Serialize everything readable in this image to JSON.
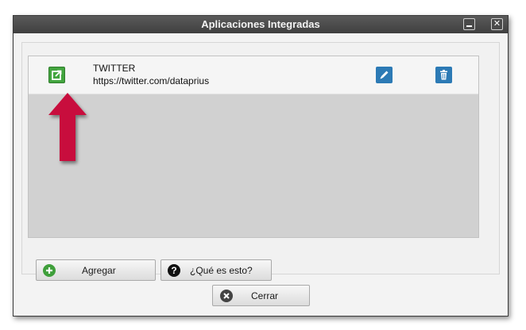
{
  "window": {
    "title": "Aplicaciones Integradas"
  },
  "apps": [
    {
      "name": "TWITTER",
      "url": "https://twitter.com/dataprius"
    }
  ],
  "buttons": {
    "add_label": "Agregar",
    "help_label": "¿Qué es esto?",
    "close_label": "Cerrar"
  },
  "icons": {
    "open": "external-link-icon",
    "edit": "pencil-icon",
    "delete": "trash-icon",
    "add": "plus-circle-icon",
    "help": "question-circle-icon",
    "close": "x-circle-icon"
  },
  "colors": {
    "titlebar": "#4a4a4a",
    "open_button": "#43a53f",
    "action_button": "#2c7ab5",
    "annotation_arrow": "#c8103c"
  }
}
